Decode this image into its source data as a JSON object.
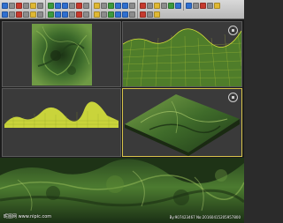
{
  "toolbar": {
    "row1_icons": [
      "undo-icon",
      "redo-icon",
      "link-icon",
      "unlink-icon",
      "bind-icon",
      "select-filter-icon",
      "select-icon",
      "select-by-name-icon",
      "region-select-icon",
      "window-crossing-icon",
      "move-icon",
      "rotate-icon",
      "scale-icon",
      "reference-coord-icon",
      "pivot-icon",
      "snap-icon",
      "angle-snap-icon",
      "percent-snap-icon",
      "spinner-snap-icon",
      "named-selection-icon",
      "mirror-icon",
      "align-icon",
      "layer-icon",
      "curve-editor-icon",
      "schematic-icon",
      "material-editor-icon",
      "render-setup-icon",
      "rendered-frame-icon",
      "render-icon"
    ],
    "row2_icons": [
      "create-icon",
      "modify-icon",
      "hierarchy-icon",
      "motion-icon",
      "display-icon",
      "utilities-icon",
      "geometry-icon",
      "shapes-icon",
      "lights-icon",
      "cameras-icon",
      "helpers-icon",
      "spacewarps-icon",
      "systems-icon",
      "grid-icon",
      "zoom-icon",
      "zoom-all-icon",
      "zoom-extents-icon",
      "field-of-view-icon",
      "pan-icon",
      "orbit-icon",
      "maximize-viewport-icon"
    ],
    "colors": {
      "accent_blue": "#2f6fd0",
      "accent_red": "#c63a2e",
      "accent_yellow": "#e0b832",
      "accent_green": "#3c9a3c",
      "neutral": "#8c8c8c"
    }
  },
  "viewports": {
    "top": {
      "label": "",
      "view": "top"
    },
    "front": {
      "label": "",
      "view": "front"
    },
    "left": {
      "label": "",
      "view": "left"
    },
    "perspective": {
      "label": "",
      "view": "perspective"
    },
    "render": {
      "label": "",
      "view": "rendered terrain"
    }
  },
  "colors": {
    "terrain_dark": "#1f3a18",
    "terrain_mid": "#3f6b2a",
    "terrain_light": "#7da34a",
    "wire_yellow": "#d9e03a",
    "active_border": "#d8c44a",
    "viewport_bg": "#3a3a3a"
  },
  "watermark": {
    "text": "昵图网 www.nipic.com",
    "id": "By:907423467 No:20160415205957800"
  }
}
